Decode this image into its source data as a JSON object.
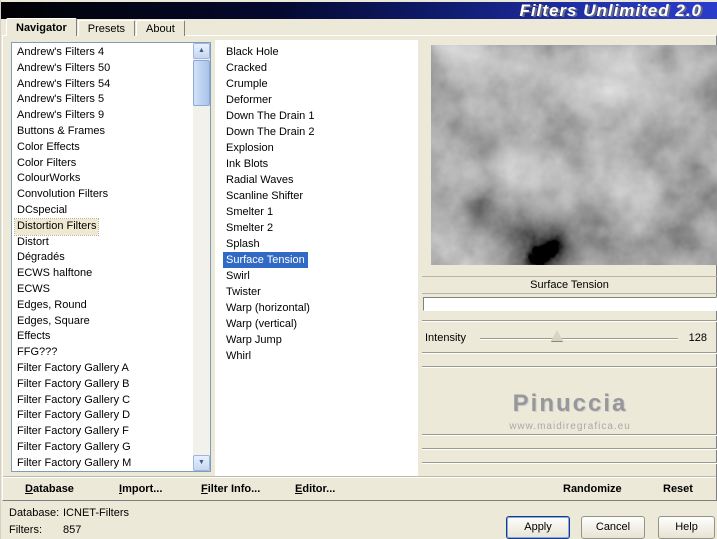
{
  "title_bar": {
    "title": "Filters Unlimited 2.0"
  },
  "tabs": {
    "navigator": "Navigator",
    "presets": "Presets",
    "about": "About"
  },
  "category_list": {
    "selected": "Distortion Filters",
    "items": [
      "Andrew's Filters 4",
      "Andrew's Filters 50",
      "Andrew's Filters 54",
      "Andrew's Filters 5",
      "Andrew's Filters 9",
      "Buttons & Frames",
      "Color Effects",
      "Color Filters",
      "ColourWorks",
      "Convolution Filters",
      "DCspecial",
      "Distortion Filters",
      "Distort",
      "Dégradés",
      "ECWS halftone",
      "ECWS",
      "Edges, Round",
      "Edges, Square",
      "Effects",
      "FFG???",
      "Filter Factory Gallery A",
      "Filter Factory Gallery B",
      "Filter Factory Gallery C",
      "Filter Factory Gallery D",
      "Filter Factory Gallery F",
      "Filter Factory Gallery G",
      "Filter Factory Gallery M"
    ]
  },
  "filter_list": {
    "selected": "Surface Tension",
    "items": [
      "Black Hole",
      "Cracked",
      "Crumple",
      "Deformer",
      "Down The Drain 1",
      "Down The Drain 2",
      "Explosion",
      "Ink Blots",
      "Radial Waves",
      "Scanline Shifter",
      "Smelter 1",
      "Smelter 2",
      "Splash",
      "Surface Tension",
      "Swirl",
      "Twister",
      "Warp (horizontal)",
      "Warp (vertical)",
      "Warp Jump",
      "Whirl"
    ]
  },
  "preview": {
    "caption": "Surface Tension",
    "texture": "gray-clouds-noise"
  },
  "sliders": {
    "intensity": {
      "label": "Intensity",
      "value": "128"
    }
  },
  "watermark": {
    "name": "Pinuccia",
    "site": "www.maidiregrafica.eu"
  },
  "toolbar": {
    "database": "Database",
    "import": "Import...",
    "filter_info": "Filter Info...",
    "editor": "Editor...",
    "randomize": "Randomize",
    "reset": "Reset"
  },
  "status": {
    "database_label": "Database:",
    "database_value": "ICNET-Filters",
    "filters_label": "Filters:",
    "filters_value": "857"
  },
  "buttons": {
    "apply": "Apply",
    "cancel": "Cancel",
    "help": "Help"
  },
  "colors": {
    "dialog": "#ECE9D8",
    "selection": "#316AC5",
    "selection_inactive": "#EFE9D2",
    "titlebar_left": "#020204",
    "titlebar_right": "#2B3CCC",
    "preview_base_gray": "#6A6A6A"
  }
}
